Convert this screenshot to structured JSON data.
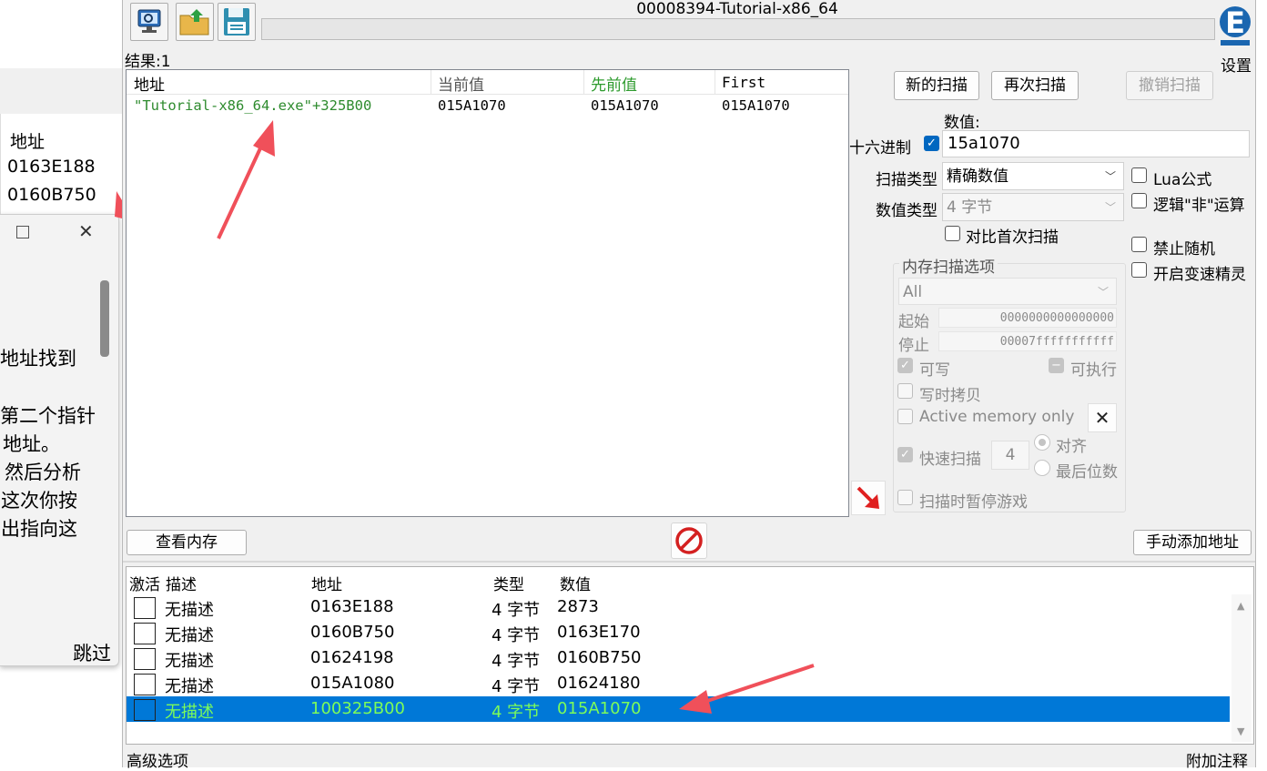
{
  "background": {
    "list_header": "地址",
    "list_rows": [
      "0163E188",
      "0160B750"
    ],
    "dialog_text": [
      "地址找到",
      "第二个指针",
      "地址。",
      "然后分析",
      "这次你按",
      "出指向这"
    ],
    "dialog_skip": "跳过"
  },
  "window": {
    "title": "00008394-Tutorial-x86_64",
    "settings_label": "设置"
  },
  "results": {
    "count_label": "结果:1",
    "columns": [
      "地址",
      "当前值",
      "先前值",
      "First"
    ],
    "rows": [
      {
        "address": "\"Tutorial-x86_64.exe\"+325B00",
        "current": "015A1070",
        "previous": "015A1070",
        "first": "015A1070"
      }
    ]
  },
  "scan": {
    "new_scan": "新的扫描",
    "next_scan": "再次扫描",
    "undo_scan": "撤销扫描",
    "value_label": "数值:",
    "hex_label": "十六进制",
    "value": "15a1070",
    "scan_type_label": "扫描类型",
    "scan_type": "精确数值",
    "value_type_label": "数值类型",
    "value_type": "4 字节",
    "compare_first": "对比首次扫描",
    "lua_formula": "Lua公式",
    "logic_not": "逻辑\"非\"运算",
    "disable_random": "禁止随机",
    "speedhack": "开启变速精灵",
    "mem_options_title": "内存扫描选项",
    "mem_region": "All",
    "start_label": "起始",
    "start_value": "0000000000000000",
    "stop_label": "停止",
    "stop_value": "00007fffffffffff",
    "writable": "可写",
    "executable": "可执行",
    "copy_on_write": "写时拷贝",
    "active_memory": "Active memory only",
    "fast_scan": "快速扫描",
    "fast_scan_value": "4",
    "align": "对齐",
    "last_digits": "最后位数",
    "pause_game": "扫描时暂停游戏"
  },
  "toolbar2": {
    "view_memory": "查看内存",
    "add_address": "手动添加地址"
  },
  "table": {
    "columns": [
      "激活",
      "描述",
      "地址",
      "类型",
      "数值"
    ],
    "rows": [
      {
        "desc": "无描述",
        "address": "0163E188",
        "type": "4 字节",
        "value": "2873"
      },
      {
        "desc": "无描述",
        "address": "0160B750",
        "type": "4 字节",
        "value": "0163E170"
      },
      {
        "desc": "无描述",
        "address": "01624198",
        "type": "4 字节",
        "value": "0160B750"
      },
      {
        "desc": "无描述",
        "address": "015A1080",
        "type": "4 字节",
        "value": "01624180"
      },
      {
        "desc": "无描述",
        "address": "100325B00",
        "type": "4 字节",
        "value": "015A1070"
      }
    ]
  },
  "statusbar": {
    "advanced": "高级选项",
    "comments": "附加注释"
  },
  "colors": {
    "selection": "#0078d7",
    "green_text": "#2e8b2e",
    "annotation_arrow": "#f0505a"
  }
}
